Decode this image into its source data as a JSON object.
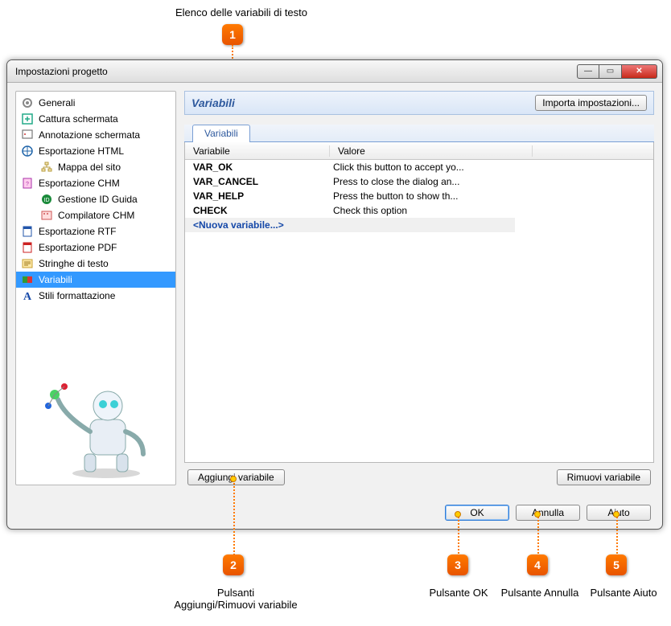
{
  "callouts": {
    "c1": {
      "num": "1",
      "label": "Elenco delle variabili di testo"
    },
    "c2": {
      "num": "2",
      "label": "Pulsanti\nAggiungi/Rimuovi variabile"
    },
    "c3": {
      "num": "3",
      "label": "Pulsante OK"
    },
    "c4": {
      "num": "4",
      "label": "Pulsante Annulla"
    },
    "c5": {
      "num": "5",
      "label": "Pulsante Aiuto"
    }
  },
  "window": {
    "title": "Impostazioni progetto"
  },
  "sidebar": {
    "items": [
      {
        "label": "Generali"
      },
      {
        "label": "Cattura schermata"
      },
      {
        "label": "Annotazione schermata"
      },
      {
        "label": "Esportazione HTML"
      },
      {
        "label": "Mappa del sito"
      },
      {
        "label": "Esportazione CHM"
      },
      {
        "label": "Gestione ID Guida"
      },
      {
        "label": "Compilatore CHM"
      },
      {
        "label": "Esportazione RTF"
      },
      {
        "label": "Esportazione PDF"
      },
      {
        "label": "Stringhe di testo"
      },
      {
        "label": "Variabili"
      },
      {
        "label": "Stili formattazione"
      }
    ]
  },
  "panel": {
    "title": "Variabili",
    "import_btn": "Importa impostazioni...",
    "tab": "Variabili",
    "headers": {
      "c1": "Variabile",
      "c2": "Valore"
    },
    "rows": [
      {
        "name": "VAR_OK",
        "value": "Click this button to accept yo..."
      },
      {
        "name": "VAR_CANCEL",
        "value": "Press to close the dialog an..."
      },
      {
        "name": "VAR_HELP",
        "value": "Press the button to show th..."
      },
      {
        "name": "CHECK",
        "value": "Check this option"
      }
    ],
    "new_row": "<Nuova variabile...>",
    "add_btn": "Aggiungi variabile",
    "remove_btn": "Rimuovi variabile"
  },
  "footer": {
    "ok": "OK",
    "cancel": "Annulla",
    "help": "Aiuto"
  }
}
